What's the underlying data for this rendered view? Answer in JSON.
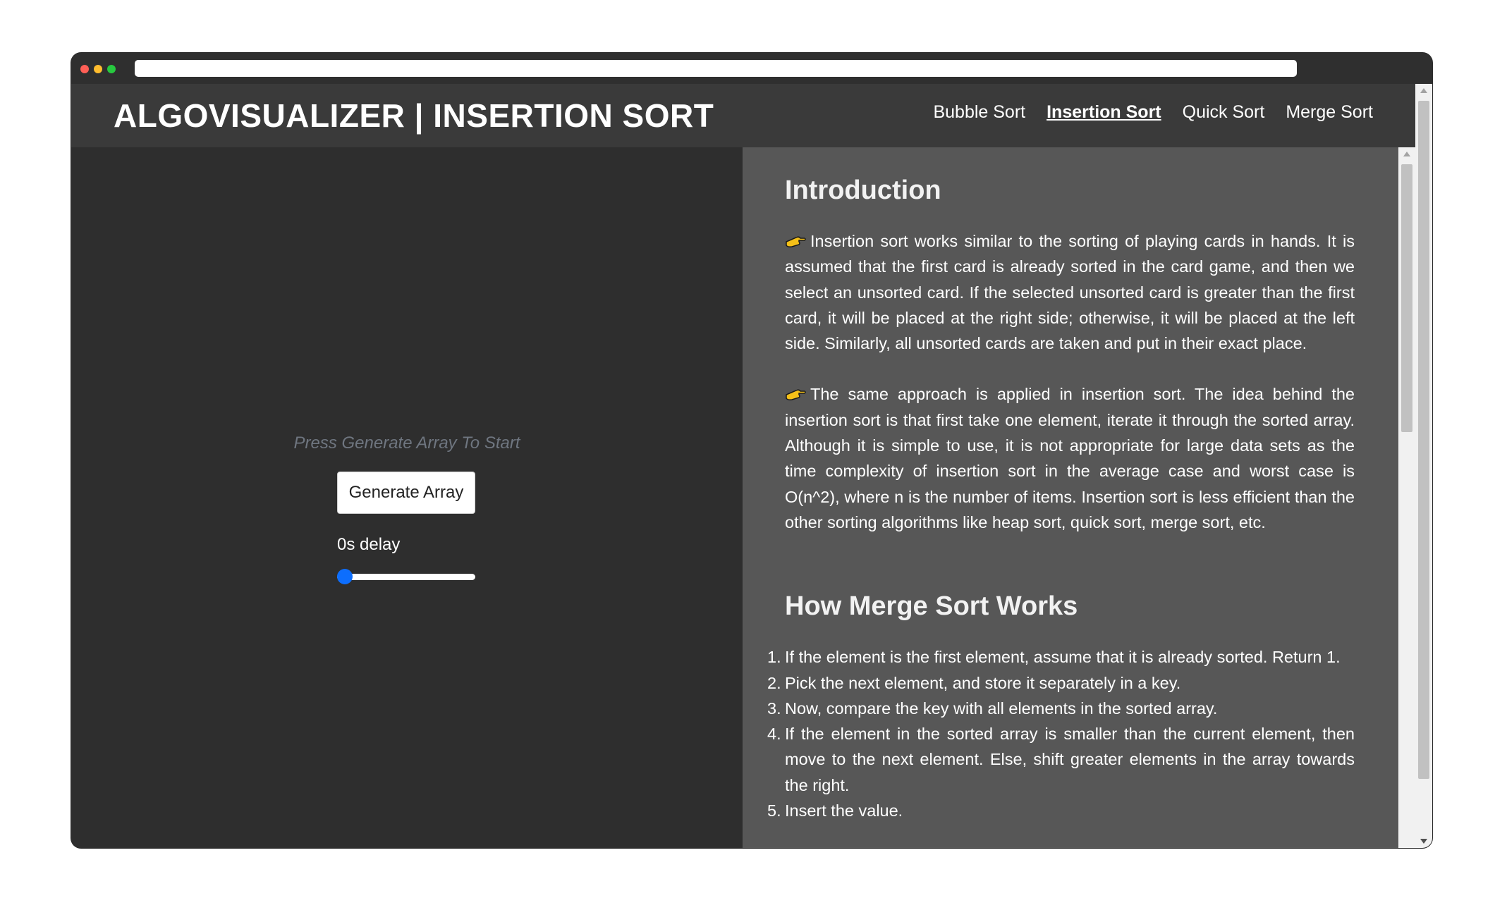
{
  "navbar": {
    "brand": "ALGOVISUALIZER | INSERTION SORT",
    "links": [
      "Bubble Sort",
      "Insertion Sort",
      "Quick Sort",
      "Merge Sort"
    ],
    "active_link": "Insertion Sort"
  },
  "controls": {
    "hint": "Press Generate Array To Start",
    "generate_button": "Generate Array",
    "delay_label": "0s delay",
    "delay_value": 0
  },
  "article": {
    "intro_heading": "Introduction",
    "intro_p1": "Insertion sort works similar to the sorting of playing cards in hands. It is assumed that the first card is already sorted in the card game, and then we select an unsorted card. If the selected unsorted card is greater than the first card, it will be placed at the right side; otherwise, it will be placed at the left side. Similarly, all unsorted cards are taken and put in their exact place.",
    "intro_p2": "The same approach is applied in insertion sort. The idea behind the insertion sort is that first take one element, iterate it through the sorted array. Although it is simple to use, it is not appropriate for large data sets as the time complexity of insertion sort in the average case and worst case is O(n^2), where n is the number of items. Insertion sort is less efficient than the other sorting algorithms like heap sort, quick sort, merge sort, etc.",
    "works_heading": "How Merge Sort Works",
    "steps": [
      "If the element is the first element, assume that it is already sorted. Return 1.",
      "Pick the next element, and store it separately in a key.",
      "Now, compare the key with all elements in the sorted array.",
      "If the element in the sorted array is smaller than the current element, then move to the next element. Else, shift greater elements in the array towards the right.",
      "Insert the value."
    ],
    "step_numbers": [
      "1.",
      "2.",
      "3.",
      "4.",
      "5."
    ]
  },
  "icons": {
    "bullet": "pointing-hand-icon"
  },
  "colors": {
    "slider_accent": "#0d6efd",
    "left_panel": "#2e2e2e",
    "right_panel": "#575757",
    "navbar": "#3a3a3a"
  }
}
